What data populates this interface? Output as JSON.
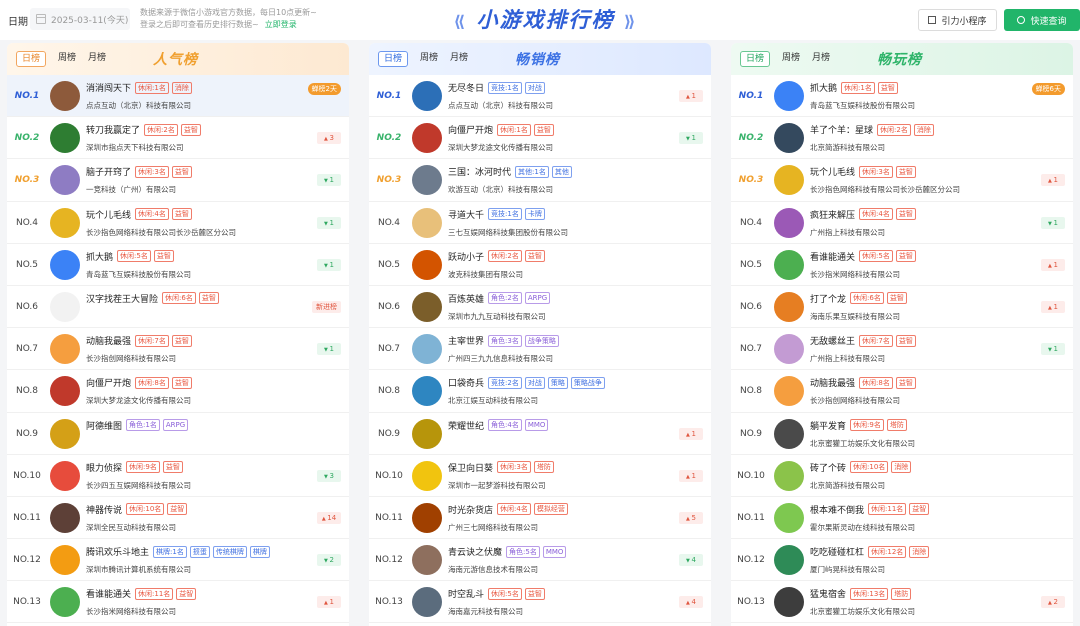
{
  "header": {
    "date_label": "日期",
    "date_value": "2025-03-11(今天)",
    "notice_line1": "数据来源于微信小游戏官方数据，每日10点更新~",
    "notice_line2": "登录之后即可查看历史排行数据~",
    "login_link": "立即登录",
    "title": "小游戏排行榜",
    "mini_program_button": "引力小程序",
    "search_button": "快速查询"
  },
  "panels": [
    {
      "title": "人气榜",
      "tabs": [
        "日榜",
        "周榜",
        "月榜"
      ],
      "rows": [
        {
          "rank": "NO.1",
          "name": "消消闯天下",
          "tags": [
            {
              "t": "休闲:1名",
              "c": "red"
            },
            {
              "t": "消除",
              "c": "red"
            }
          ],
          "company": "点点互动（北京）科技有限公司",
          "change": "蝉榜2天",
          "dir": "badge",
          "avatar": "#8d5a3b"
        },
        {
          "rank": "NO.2",
          "name": "转刀我赢定了",
          "tags": [
            {
              "t": "休闲:2名",
              "c": "red"
            },
            {
              "t": "益智",
              "c": "red"
            }
          ],
          "company": "深圳市指点天下科技有限公司",
          "change": "3",
          "dir": "up",
          "avatar": "#2e7d32"
        },
        {
          "rank": "NO.3",
          "name": "脑子开窍了",
          "tags": [
            {
              "t": "休闲:3名",
              "c": "red"
            },
            {
              "t": "益智",
              "c": "red"
            }
          ],
          "company": "一竞科技（广州）有限公司",
          "change": "1",
          "dir": "down",
          "avatar": "#8e7cc3"
        },
        {
          "rank": "NO.4",
          "name": "玩个儿毛线",
          "tags": [
            {
              "t": "休闲:4名",
              "c": "red"
            },
            {
              "t": "益智",
              "c": "red"
            }
          ],
          "company": "长沙指色网络科技有限公司长沙岳麓区分公司",
          "change": "1",
          "dir": "down",
          "avatar": "#e6b422"
        },
        {
          "rank": "NO.5",
          "name": "抓大鹅",
          "tags": [
            {
              "t": "休闲:5名",
              "c": "red"
            },
            {
              "t": "益智",
              "c": "red"
            }
          ],
          "company": "青岛蓝飞互娱科技股份有限公司",
          "change": "1",
          "dir": "down",
          "avatar": "#3b82f6"
        },
        {
          "rank": "NO.6",
          "name": "汉字找茬王大冒险",
          "tags": [
            {
              "t": "休闲:6名",
              "c": "red"
            },
            {
              "t": "益智",
              "c": "red"
            }
          ],
          "company": "",
          "change": "新进榜",
          "dir": "new",
          "avatar": "#f2f2f2"
        },
        {
          "rank": "NO.7",
          "name": "动脑我最强",
          "tags": [
            {
              "t": "休闲:7名",
              "c": "red"
            },
            {
              "t": "益智",
              "c": "red"
            }
          ],
          "company": "长沙指创网络科技有限公司",
          "change": "1",
          "dir": "down",
          "avatar": "#f59e3f"
        },
        {
          "rank": "NO.8",
          "name": "向僵尸开炮",
          "tags": [
            {
              "t": "休闲:8名",
              "c": "red"
            },
            {
              "t": "益智",
              "c": "red"
            }
          ],
          "company": "深圳大梦龙途文化传播有限公司",
          "change": "",
          "dir": "none",
          "avatar": "#c0392b"
        },
        {
          "rank": "NO.9",
          "name": "阿德维图",
          "tags": [
            {
              "t": "角色:1名",
              "c": "purple"
            },
            {
              "t": "ARPG",
              "c": "purple"
            }
          ],
          "company": "",
          "change": "",
          "dir": "none",
          "avatar": "#d4a017"
        },
        {
          "rank": "NO.10",
          "name": "眼力侦探",
          "tags": [
            {
              "t": "休闲:9名",
              "c": "red"
            },
            {
              "t": "益智",
              "c": "red"
            }
          ],
          "company": "长沙四五互娱网络科技有限公司",
          "change": "3",
          "dir": "down",
          "avatar": "#e74c3c"
        },
        {
          "rank": "NO.11",
          "name": "神器传说",
          "tags": [
            {
              "t": "休闲:10名",
              "c": "red"
            },
            {
              "t": "益智",
              "c": "red"
            }
          ],
          "company": "深圳全民互动科技有限公司",
          "change": "14",
          "dir": "up",
          "avatar": "#5d4037"
        },
        {
          "rank": "NO.12",
          "name": "腾讯欢乐斗地主",
          "tags": [
            {
              "t": "棋牌:1名",
              "c": "blue"
            },
            {
              "t": "掼蛋",
              "c": "blue"
            },
            {
              "t": "传统棋牌",
              "c": "blue"
            },
            {
              "t": "棋牌",
              "c": "blue"
            }
          ],
          "company": "深圳市腾讯计算机系统有限公司",
          "change": "2",
          "dir": "down",
          "avatar": "#f39c12"
        },
        {
          "rank": "NO.13",
          "name": "看谁能通关",
          "tags": [
            {
              "t": "休闲:11名",
              "c": "red"
            },
            {
              "t": "益智",
              "c": "red"
            }
          ],
          "company": "长沙指米网络科技有限公司",
          "change": "1",
          "dir": "up",
          "avatar": "#4caf50"
        }
      ]
    },
    {
      "title": "畅销榜",
      "tabs": [
        "日榜",
        "周榜",
        "月榜"
      ],
      "rows": [
        {
          "rank": "NO.1",
          "name": "无尽冬日",
          "tags": [
            {
              "t": "竞技:1名",
              "c": "blue"
            },
            {
              "t": "对战",
              "c": "blue"
            }
          ],
          "company": "点点互动（北京）科技有限公司",
          "change": "1",
          "dir": "up",
          "avatar": "#2c6fb7"
        },
        {
          "rank": "NO.2",
          "name": "向僵尸开炮",
          "tags": [
            {
              "t": "休闲:1名",
              "c": "red"
            },
            {
              "t": "益智",
              "c": "red"
            }
          ],
          "company": "深圳大梦龙途文化传播有限公司",
          "change": "1",
          "dir": "down",
          "avatar": "#c0392b"
        },
        {
          "rank": "NO.3",
          "name": "三国：冰河时代",
          "tags": [
            {
              "t": "其他:1名",
              "c": "blue"
            },
            {
              "t": "其他",
              "c": "blue"
            }
          ],
          "company": "欢游互动（北京）科技有限公司",
          "change": "",
          "dir": "none",
          "avatar": "#6d7b8d"
        },
        {
          "rank": "NO.4",
          "name": "寻道大千",
          "tags": [
            {
              "t": "竞技:1名",
              "c": "blue"
            },
            {
              "t": "卡牌",
              "c": "blue"
            }
          ],
          "company": "三七互娱网络科技集团股份有限公司",
          "change": "",
          "dir": "none",
          "avatar": "#e8c07a"
        },
        {
          "rank": "NO.5",
          "name": "跃动小子",
          "tags": [
            {
              "t": "休闲:2名",
              "c": "red"
            },
            {
              "t": "益智",
              "c": "red"
            }
          ],
          "company": "波克科技集团有限公司",
          "change": "",
          "dir": "none",
          "avatar": "#d35400"
        },
        {
          "rank": "NO.6",
          "name": "百炼英雄",
          "tags": [
            {
              "t": "角色:2名",
              "c": "purple"
            },
            {
              "t": "ARPG",
              "c": "purple"
            }
          ],
          "company": "深圳市九九互动科技有限公司",
          "change": "",
          "dir": "none",
          "avatar": "#7b5e2a"
        },
        {
          "rank": "NO.7",
          "name": "主宰世界",
          "tags": [
            {
              "t": "角色:3名",
              "c": "purple"
            },
            {
              "t": "战争策略",
              "c": "purple"
            }
          ],
          "company": "广州四三九九信息科技有限公司",
          "change": "",
          "dir": "none",
          "avatar": "#7fb3d5"
        },
        {
          "rank": "NO.8",
          "name": "口袋奇兵",
          "tags": [
            {
              "t": "竞技:2名",
              "c": "blue"
            },
            {
              "t": "对战",
              "c": "blue"
            },
            {
              "t": "策略",
              "c": "blue"
            },
            {
              "t": "策略战争",
              "c": "blue"
            }
          ],
          "company": "北京江娱互动科技有限公司",
          "change": "",
          "dir": "none",
          "avatar": "#2e86c1"
        },
        {
          "rank": "NO.9",
          "name": "荣耀世纪",
          "tags": [
            {
              "t": "角色:4名",
              "c": "purple"
            },
            {
              "t": "MMO",
              "c": "purple"
            }
          ],
          "company": "",
          "change": "1",
          "dir": "up",
          "avatar": "#b7950b"
        },
        {
          "rank": "NO.10",
          "name": "保卫向日葵",
          "tags": [
            {
              "t": "休闲:3名",
              "c": "red"
            },
            {
              "t": "塔防",
              "c": "red"
            }
          ],
          "company": "深圳市一起梦游科技有限公司",
          "change": "1",
          "dir": "up",
          "avatar": "#f1c40f"
        },
        {
          "rank": "NO.11",
          "name": "时光杂货店",
          "tags": [
            {
              "t": "休闲:4名",
              "c": "red"
            },
            {
              "t": "模拟经营",
              "c": "red"
            }
          ],
          "company": "广州三七网络科技有限公司",
          "change": "5",
          "dir": "up",
          "avatar": "#a04000"
        },
        {
          "rank": "NO.12",
          "name": "青云诀之伏魔",
          "tags": [
            {
              "t": "角色:5名",
              "c": "purple"
            },
            {
              "t": "MMO",
              "c": "purple"
            }
          ],
          "company": "海南元游信息技术有限公司",
          "change": "4",
          "dir": "down",
          "avatar": "#8e6f5e"
        },
        {
          "rank": "NO.13",
          "name": "时空乱斗",
          "tags": [
            {
              "t": "休闲:5名",
              "c": "red"
            },
            {
              "t": "益智",
              "c": "red"
            }
          ],
          "company": "海南嘉元科技有限公司",
          "change": "4",
          "dir": "up",
          "avatar": "#5b6c7d"
        }
      ]
    },
    {
      "title": "畅玩榜",
      "tabs": [
        "日榜",
        "周榜",
        "月榜"
      ],
      "rows": [
        {
          "rank": "NO.1",
          "name": "抓大鹅",
          "tags": [
            {
              "t": "休闲:1名",
              "c": "red"
            },
            {
              "t": "益智",
              "c": "red"
            }
          ],
          "company": "青岛蓝飞互娱科技股份有限公司",
          "change": "蝉榜6天",
          "dir": "badge",
          "avatar": "#3b82f6"
        },
        {
          "rank": "NO.2",
          "name": "羊了个羊：星球",
          "tags": [
            {
              "t": "休闲:2名",
              "c": "red"
            },
            {
              "t": "消除",
              "c": "red"
            }
          ],
          "company": "北京简游科技有限公司",
          "change": "",
          "dir": "none",
          "avatar": "#34495e"
        },
        {
          "rank": "NO.3",
          "name": "玩个儿毛线",
          "tags": [
            {
              "t": "休闲:3名",
              "c": "red"
            },
            {
              "t": "益智",
              "c": "red"
            }
          ],
          "company": "长沙指色网络科技有限公司长沙岳麓区分公司",
          "change": "1",
          "dir": "up",
          "avatar": "#e6b422"
        },
        {
          "rank": "NO.4",
          "name": "疯狂来解压",
          "tags": [
            {
              "t": "休闲:4名",
              "c": "red"
            },
            {
              "t": "益智",
              "c": "red"
            }
          ],
          "company": "广州指上科技有限公司",
          "change": "1",
          "dir": "down",
          "avatar": "#9b59b6"
        },
        {
          "rank": "NO.5",
          "name": "看谁能通关",
          "tags": [
            {
              "t": "休闲:5名",
              "c": "red"
            },
            {
              "t": "益智",
              "c": "red"
            }
          ],
          "company": "长沙指米网络科技有限公司",
          "change": "1",
          "dir": "up",
          "avatar": "#4caf50"
        },
        {
          "rank": "NO.6",
          "name": "打了个龙",
          "tags": [
            {
              "t": "休闲:6名",
              "c": "red"
            },
            {
              "t": "益智",
              "c": "red"
            }
          ],
          "company": "海南乐果互娱科技有限公司",
          "change": "1",
          "dir": "up",
          "avatar": "#e67e22"
        },
        {
          "rank": "NO.7",
          "name": "无敌螺丝王",
          "tags": [
            {
              "t": "休闲:7名",
              "c": "red"
            },
            {
              "t": "益智",
              "c": "red"
            }
          ],
          "company": "广州指上科技有限公司",
          "change": "1",
          "dir": "down",
          "avatar": "#c39bd3"
        },
        {
          "rank": "NO.8",
          "name": "动脑我最强",
          "tags": [
            {
              "t": "休闲:8名",
              "c": "red"
            },
            {
              "t": "益智",
              "c": "red"
            }
          ],
          "company": "长沙指创网络科技有限公司",
          "change": "",
          "dir": "none",
          "avatar": "#f59e3f"
        },
        {
          "rank": "NO.9",
          "name": "躺平发育",
          "tags": [
            {
              "t": "休闲:9名",
              "c": "red"
            },
            {
              "t": "塔防",
              "c": "red"
            }
          ],
          "company": "北京蜜獾工坊娱乐文化有限公司",
          "change": "",
          "dir": "none",
          "avatar": "#4a4a4a"
        },
        {
          "rank": "NO.10",
          "name": "砖了个砖",
          "tags": [
            {
              "t": "休闲:10名",
              "c": "red"
            },
            {
              "t": "消除",
              "c": "red"
            }
          ],
          "company": "北京简游科技有限公司",
          "change": "",
          "dir": "none",
          "avatar": "#8bc34a"
        },
        {
          "rank": "NO.11",
          "name": "根本难不倒我",
          "tags": [
            {
              "t": "休闲:11名",
              "c": "red"
            },
            {
              "t": "益智",
              "c": "red"
            }
          ],
          "company": "霍尔果斯灵动在线科技有限公司",
          "change": "",
          "dir": "none",
          "avatar": "#7ec850"
        },
        {
          "rank": "NO.12",
          "name": "吃吃碰碰杠杠",
          "tags": [
            {
              "t": "休闲:12名",
              "c": "red"
            },
            {
              "t": "消除",
              "c": "red"
            }
          ],
          "company": "厦门屿晃科技有限公司",
          "change": "",
          "dir": "none",
          "avatar": "#2e8b57"
        },
        {
          "rank": "NO.13",
          "name": "猛鬼宿舍",
          "tags": [
            {
              "t": "休闲:13名",
              "c": "red"
            },
            {
              "t": "塔防",
              "c": "red"
            }
          ],
          "company": "北京蜜獾工坊娱乐文化有限公司",
          "change": "2",
          "dir": "up",
          "avatar": "#3d3d3d"
        }
      ]
    }
  ]
}
